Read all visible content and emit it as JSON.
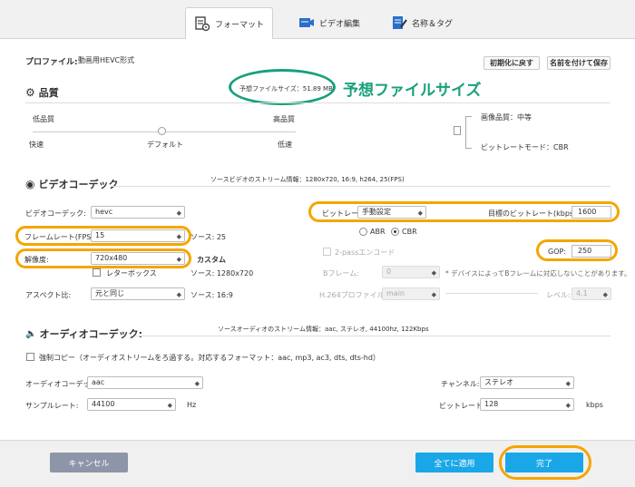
{
  "tabs": [
    {
      "label": "フォーマット",
      "icon": "format-icon"
    },
    {
      "label": "ビデオ編集",
      "icon": "video-edit-icon"
    },
    {
      "label": "名称＆タグ",
      "icon": "name-tag-icon"
    }
  ],
  "profile": {
    "label": "プロファイル:",
    "value": "動画用HEVC形式"
  },
  "buttons": {
    "reset": "初期化に戻す",
    "save_as": "名前を付けて保存",
    "cancel": "キャンセル",
    "apply_all": "全てに適用",
    "done": "完了"
  },
  "filesize": {
    "text": "予想ファイルサイズ：51.89 MB",
    "annotation": "予想ファイルサイズ"
  },
  "quality": {
    "title": "品質",
    "low": "低品質",
    "high": "高品質",
    "fast": "快速",
    "default": "デフォルト",
    "slow": "低速",
    "slider_level": 0.5,
    "image_quality": "画像品質：中等",
    "bitrate_mode": "ビットレートモード：CBR"
  },
  "video": {
    "title": "ビデオコーデック",
    "stream_info": "ソースビデオのストリーム情報：1280x720, 16:9, h264, 25(FPS)",
    "codec_label": "ビデオコーデック:",
    "codec": "hevc",
    "fps_label": "フレームレート(FPS):",
    "fps": "15",
    "fps_source": "ソース: 25",
    "res_label": "解像度:",
    "res": "720x480",
    "custom": "カスタム",
    "letterbox": "レターボックス",
    "res_source": "ソース: 1280x720",
    "aspect_label": "アスペクト比:",
    "aspect": "元と同じ",
    "aspect_source": "ソース: 16:9",
    "bitrate_label": "ビットレート:",
    "bitrate_mode": "手動設定",
    "target_label": "目標のビットレート(kbps):",
    "target": "1600",
    "abr": "ABR",
    "cbr": "CBR",
    "two_pass": "2-passエンコード",
    "gop_label": "GOP:",
    "gop": "250",
    "bframe_label": "Bフレーム:",
    "bframe": "0",
    "bframe_note": "* デバイスによってBフレームに対応しないことがあります。",
    "h264_label": "H.264プロファイル:",
    "h264": "main",
    "level_label": "レベル:",
    "level": "4.1"
  },
  "audio": {
    "title": "オーディオコーデック:",
    "stream_info": "ソースオーディオのストリーム情報：aac, ステレオ, 44100hz, 122Kbps",
    "force_copy": "強制コピー（オーディオストリームをろ過する。対応するフォーマット：aac, mp3, ac3, dts, dts-hd）",
    "codec_label": "オーディオコーデック:",
    "codec": "aac",
    "sample_label": "サンプルレート:",
    "sample": "44100",
    "hz": "Hz",
    "channel_label": "チャンネル:",
    "channel": "ステレオ",
    "bitrate_label": "ビットレート:",
    "bitrate": "128",
    "kbps": "kbps"
  },
  "colors": {
    "accent_blue": "#1aa7e8",
    "highlight_orange": "#f5a500",
    "annotation_green": "#17a07c"
  }
}
